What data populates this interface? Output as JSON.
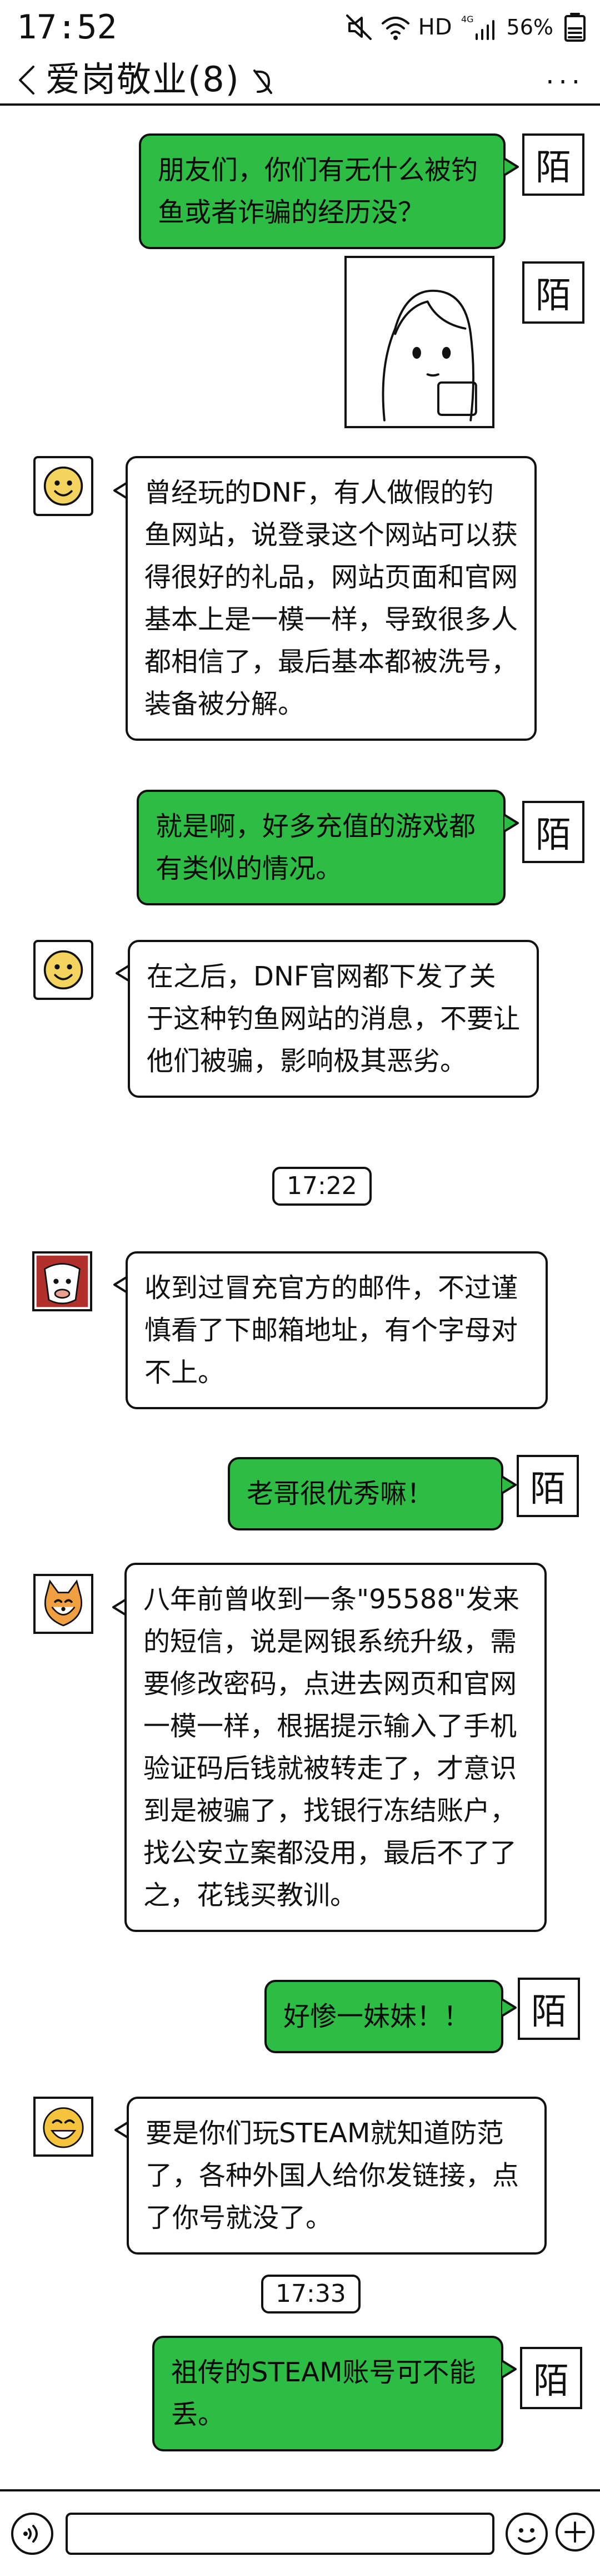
{
  "status_bar": {
    "time": "17:52",
    "network": "HD",
    "signal_label": "4G",
    "battery": "56%"
  },
  "header": {
    "title": "爱岗敬业(8)",
    "more_label": "···"
  },
  "self_avatar_char": "陌",
  "messages": [
    {
      "text": "朋友们，你们有无什么被钓鱼或者诈骗的经历没？"
    },
    {
      "text": "曾经玩的DNF，有人做假的钓鱼网站，说登录这个网站可以获得很好的礼品，网站页面和官网基本上是一模一样，导致很多人都相信了，最后基本都被洗号，装备被分解。"
    },
    {
      "text": "就是啊，好多充值的游戏都有类似的情况。"
    },
    {
      "text": "在之后，DNF官网都下发了关于这种钓鱼网站的消息，不要让他们被骗，影响极其恶劣。"
    },
    {
      "text": "收到过冒充官方的邮件，不过谨慎看了下邮箱地址，有个字母对不上。"
    },
    {
      "text": "老哥很优秀嘛！"
    },
    {
      "text": "八年前曾收到一条\"95588\"发来的短信，说是网银系统升级，需要修改密码，点进去网页和官网一模一样，根据提示输入了手机验证码后钱就被转走了，才意识到是被骗了，找银行冻结账户，找公安立案都没用，最后不了了之，花钱买教训。"
    },
    {
      "text": "好惨一妹妹！！"
    },
    {
      "text": "要是你们玩STEAM就知道防范了，各种外国人给你发链接，点了你号就没了。"
    },
    {
      "text": "祖传的STEAM账号可不能丢。"
    }
  ],
  "timestamps": [
    "17:22",
    "17:33"
  ],
  "input": {
    "placeholder": ""
  }
}
